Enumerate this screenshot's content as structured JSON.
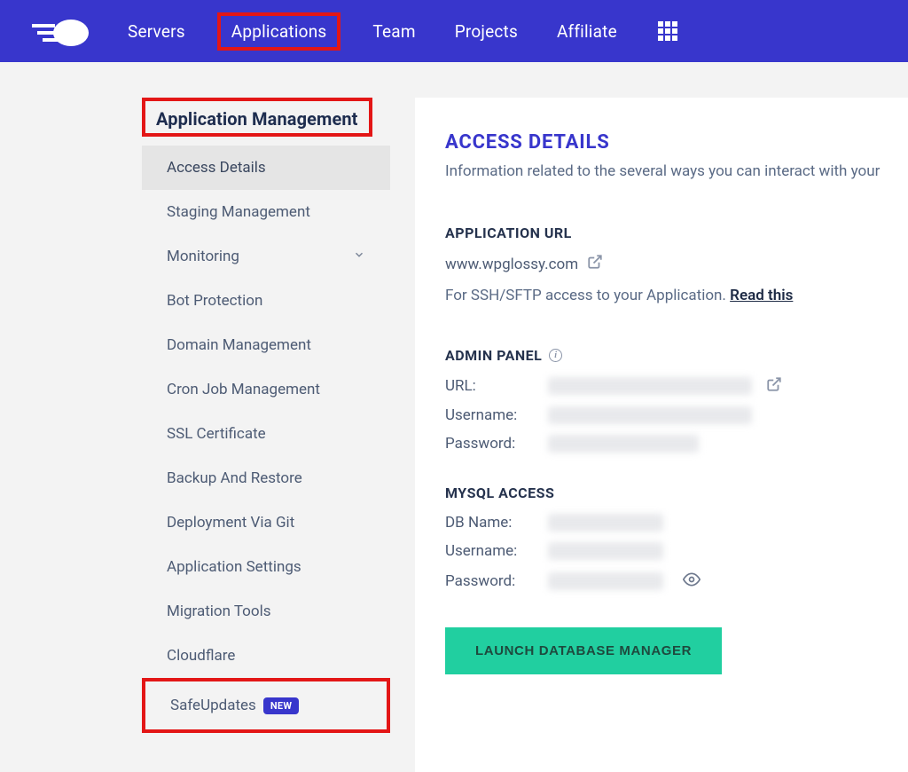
{
  "nav": {
    "servers": "Servers",
    "applications": "Applications",
    "team": "Team",
    "projects": "Projects",
    "affiliate": "Affiliate"
  },
  "sidebar": {
    "title": "Application Management",
    "items": [
      {
        "label": "Access Details"
      },
      {
        "label": "Staging Management"
      },
      {
        "label": "Monitoring"
      },
      {
        "label": "Bot Protection"
      },
      {
        "label": "Domain Management"
      },
      {
        "label": "Cron Job Management"
      },
      {
        "label": "SSL Certificate"
      },
      {
        "label": "Backup And Restore"
      },
      {
        "label": "Deployment Via Git"
      },
      {
        "label": "Application Settings"
      },
      {
        "label": "Migration Tools"
      },
      {
        "label": "Cloudflare"
      },
      {
        "label": "SafeUpdates"
      }
    ],
    "new_badge": "NEW"
  },
  "main": {
    "title": "ACCESS DETAILS",
    "subtitle": "Information related to the several ways you can interact with your",
    "app_url_heading": "APPLICATION URL",
    "app_url": "www.wpglossy.com",
    "ssh_line_pre": "For SSH/SFTP access to your Application. ",
    "ssh_link": "Read this",
    "admin_heading": "ADMIN PANEL",
    "admin_url_label": "URL:",
    "admin_user_label": "Username:",
    "admin_pass_label": "Password:",
    "mysql_heading": "MYSQL ACCESS",
    "mysql_db_label": "DB Name:",
    "mysql_user_label": "Username:",
    "mysql_pass_label": "Password:",
    "launch_btn": "LAUNCH DATABASE MANAGER"
  }
}
